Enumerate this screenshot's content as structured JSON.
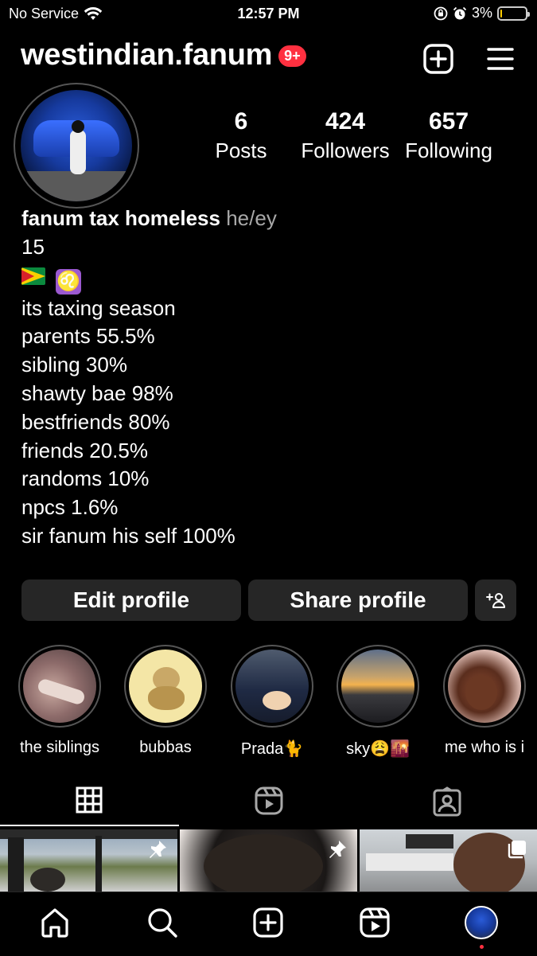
{
  "status_bar": {
    "carrier": "No Service",
    "time": "12:57 PM",
    "battery_percent": "3%",
    "battery_level": 0.03
  },
  "header": {
    "username": "westindian.fanum",
    "notification_badge": "9+"
  },
  "stats": [
    {
      "value": "6",
      "label": "Posts"
    },
    {
      "value": "424",
      "label": "Followers"
    },
    {
      "value": "657",
      "label": "Following"
    }
  ],
  "bio": {
    "name": "fanum tax homeless",
    "pronouns": "he/ey",
    "lines": [
      "15",
      "its taxing season",
      "parents 55.5%",
      "sibling 30%",
      "shawty bae 98%",
      "bestfriends 80%",
      "friends 20.5%",
      "randoms 10%",
      "npcs 1.6%",
      "sir fanum his self 100%"
    ]
  },
  "buttons": {
    "edit_profile": "Edit profile",
    "share_profile": "Share profile"
  },
  "highlights": [
    {
      "label": "the siblings"
    },
    {
      "label": "bubbas"
    },
    {
      "label": "Prada🐈"
    },
    {
      "label": "sky😩🌇"
    },
    {
      "label": "me who is i"
    }
  ],
  "icons": {
    "header": [
      "new-post-icon",
      "menu-icon"
    ],
    "tabs": [
      "grid-icon",
      "reels-icon",
      "tagged-icon"
    ],
    "nav": [
      "home-icon",
      "search-icon",
      "create-icon",
      "reels-icon",
      "profile-avatar"
    ]
  },
  "colors": {
    "background": "#000000",
    "button": "#262626",
    "badge": "#ff3040",
    "secondary_text": "#a8a8a8"
  }
}
